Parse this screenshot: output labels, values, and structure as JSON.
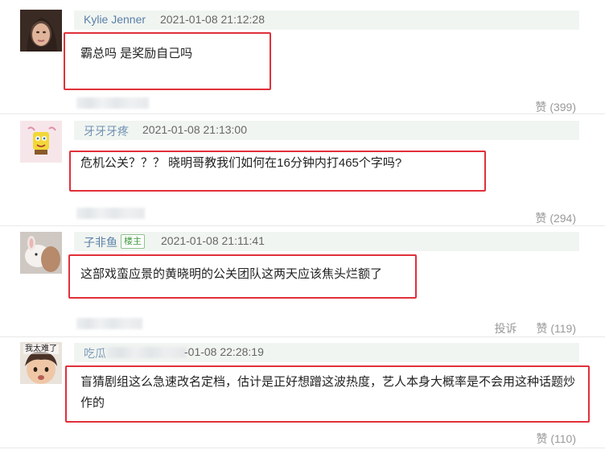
{
  "comments": [
    {
      "user": "Kylie Jenner",
      "time": "2021-01-08 21:12:28",
      "text": "霸总吗 是奖励自己吗",
      "like_label": "赞",
      "like_count": "(399)"
    },
    {
      "user": "牙牙牙疼",
      "time": "2021-01-08 21:13:00",
      "text": "危机公关？？？ 晓明哥教我们如何在16分钟内打465个字吗?",
      "like_label": "赞",
      "like_count": "(294)"
    },
    {
      "user": "子非鱼",
      "badge": "楼主",
      "time": "2021-01-08 21:11:41",
      "text": "这部戏蛮应景的黄晓明的公关团队这两天应该焦头烂额了",
      "report_label": "投诉",
      "like_label": "赞",
      "like_count": "(119)"
    },
    {
      "user": "吃瓜",
      "avatar_caption": "我太难了",
      "time": "-01-08 22:28:19",
      "text": "盲猜剧组这么急速改名定档，估计是正好想蹭这波热度，艺人本身大概率是不会用这种话题炒作的",
      "like_label": "赞",
      "like_count": "(110)"
    }
  ],
  "colors": {
    "highlight": "#e1303a",
    "username": "#5a7fa8",
    "badge": "#3e9a3e"
  }
}
